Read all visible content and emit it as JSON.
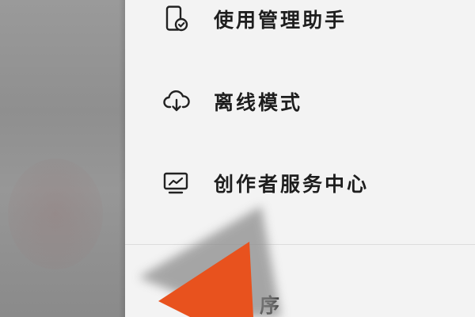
{
  "menu": {
    "items": [
      {
        "label": "使用管理助手",
        "icon": "phone-clock-icon"
      },
      {
        "label": "离线模式",
        "icon": "cloud-download-icon"
      },
      {
        "label": "创作者服务中心",
        "icon": "monitor-chart-icon"
      }
    ],
    "partial_item_label": "序"
  },
  "colors": {
    "drawer_bg": "#f3f3f3",
    "text": "#1e1e1e",
    "pointer": "#e8521e"
  }
}
